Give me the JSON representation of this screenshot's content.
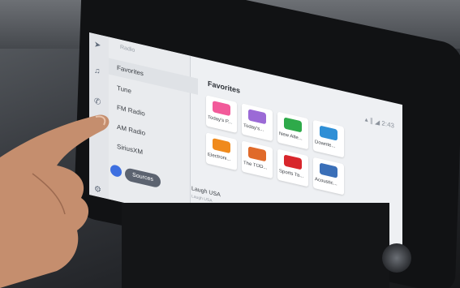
{
  "sidebar": {
    "title": "Radio",
    "items": [
      {
        "label": "Favorites"
      },
      {
        "label": "Tune"
      },
      {
        "label": "FM Radio"
      },
      {
        "label": "AM Radio"
      },
      {
        "label": "SiriusXM"
      }
    ],
    "sources_label": "Sources"
  },
  "header": {
    "title": "Favorites",
    "time": "2:43"
  },
  "stations": [
    {
      "name": "Today's P...",
      "color": "#f25a9a"
    },
    {
      "name": "Today's...",
      "color": "#9b6ad6"
    },
    {
      "name": "New Alte...",
      "color": "#2eaa4a"
    },
    {
      "name": "Downte...",
      "color": "#2f8fd6"
    },
    {
      "name": "Electroni...",
      "color": "#f08a1c"
    },
    {
      "name": "The TOD...",
      "color": "#e06a2a"
    },
    {
      "name": "Sports Ta...",
      "color": "#d8262c"
    },
    {
      "name": "Acoustic...",
      "color": "#3a6fb8"
    }
  ],
  "now_playing": {
    "title": "Laugh USA",
    "subtitle": "Laugh USA"
  }
}
